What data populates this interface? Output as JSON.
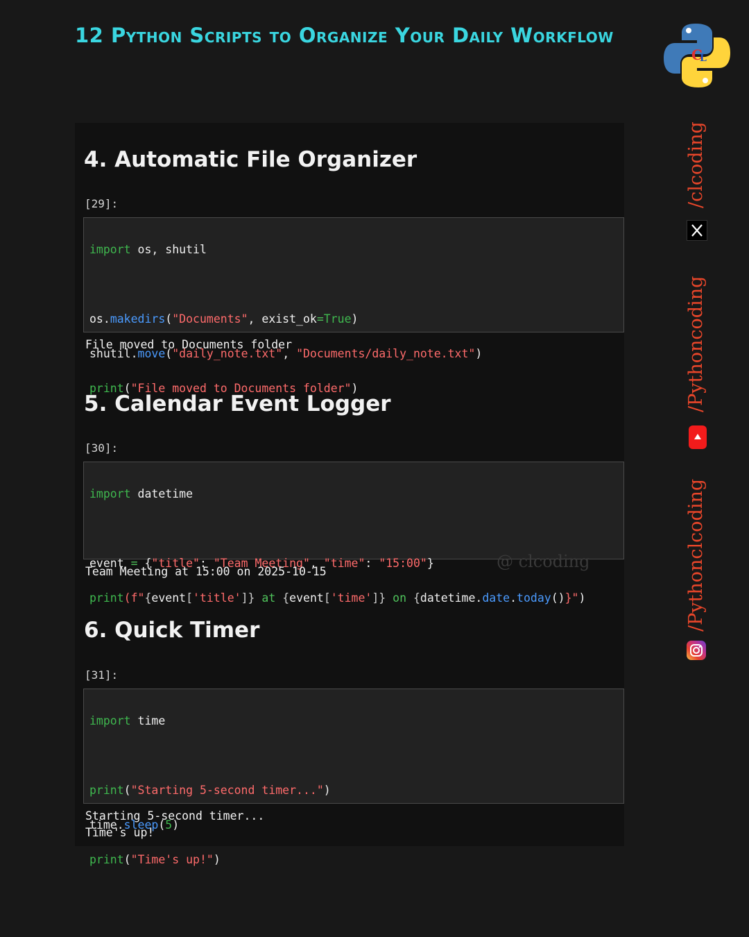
{
  "header": {
    "title": "12 Python Scripts to Organize Your Daily Workflow"
  },
  "sections": [
    {
      "heading": "4. Automatic File Organizer",
      "prompt": "[29]:",
      "output": [
        "File moved to Documents folder"
      ]
    },
    {
      "heading": "5. Calendar Event Logger",
      "prompt": "[30]:",
      "output": [
        "Team Meeting at 15:00 on 2025-10-15"
      ]
    },
    {
      "heading": "6. Quick Timer",
      "prompt": "[31]:",
      "output": [
        "Starting 5-second timer...",
        "Time's up!"
      ]
    }
  ],
  "code": {
    "c29": {
      "l1a": "import",
      "l1b": " os, shutil",
      "l3a": "os.",
      "l3b": "makedirs",
      "l3c": "(",
      "l3d": "\"Documents\"",
      "l3e": ", exist_ok",
      "l3f": "=",
      "l3g": "True",
      "l3h": ")",
      "l4a": "shutil.",
      "l4b": "move",
      "l4c": "(",
      "l4d": "\"daily_note.txt\"",
      "l4e": ", ",
      "l4f": "\"Documents/daily_note.txt\"",
      "l4g": ")",
      "l5a": "print",
      "l5b": "(",
      "l5c": "\"File moved to Documents folder\"",
      "l5d": ")"
    },
    "c30": {
      "l1a": "import",
      "l1b": " datetime",
      "l3a": "event ",
      "l3b": "=",
      "l3c": " {",
      "l3d": "\"title\"",
      "l3e": ": ",
      "l3f": "\"Team Meeting\"",
      "l3g": ", ",
      "l3h": "\"time\"",
      "l3i": ": ",
      "l3j": "\"15:00\"",
      "l3k": "}",
      "l4a": "print",
      "l4b": "(f",
      "l4c": "\"",
      "l4d": "{",
      "l4e": "event",
      "l4f": "[",
      "l4g": "'title'",
      "l4h": "]}",
      "l4i": " at ",
      "l4j": "{",
      "l4k": "event",
      "l4l": "[",
      "l4m": "'time'",
      "l4n": "]}",
      "l4o": " on ",
      "l4p": "{",
      "l4q": "datetime.",
      "l4r": "date",
      "l4s": ".",
      "l4t": "today",
      "l4u": "()",
      "l4v": "}\"",
      "l4w": ")"
    },
    "c31": {
      "l1a": "import",
      "l1b": " time",
      "l3a": "print",
      "l3b": "(",
      "l3c": "\"Starting 5-second timer...\"",
      "l3d": ")",
      "l4a": "time.",
      "l4b": "sleep",
      "l4c": "(",
      "l4d": "5",
      "l4e": ")",
      "l5a": "print",
      "l5b": "(",
      "l5c": "\"Time's up!\"",
      "l5d": ")"
    }
  },
  "watermark": "@ clcoding",
  "social": {
    "x_handle": "/clcoding",
    "youtube_handle": "/Pythoncoding",
    "instagram_handle": "/Pythonclcoding"
  },
  "colors": {
    "title": "#3ad6e0",
    "keyword": "#3fb94f",
    "string": "#ff6b6b",
    "function": "#4b9bff",
    "social_text": "#e8462a"
  }
}
